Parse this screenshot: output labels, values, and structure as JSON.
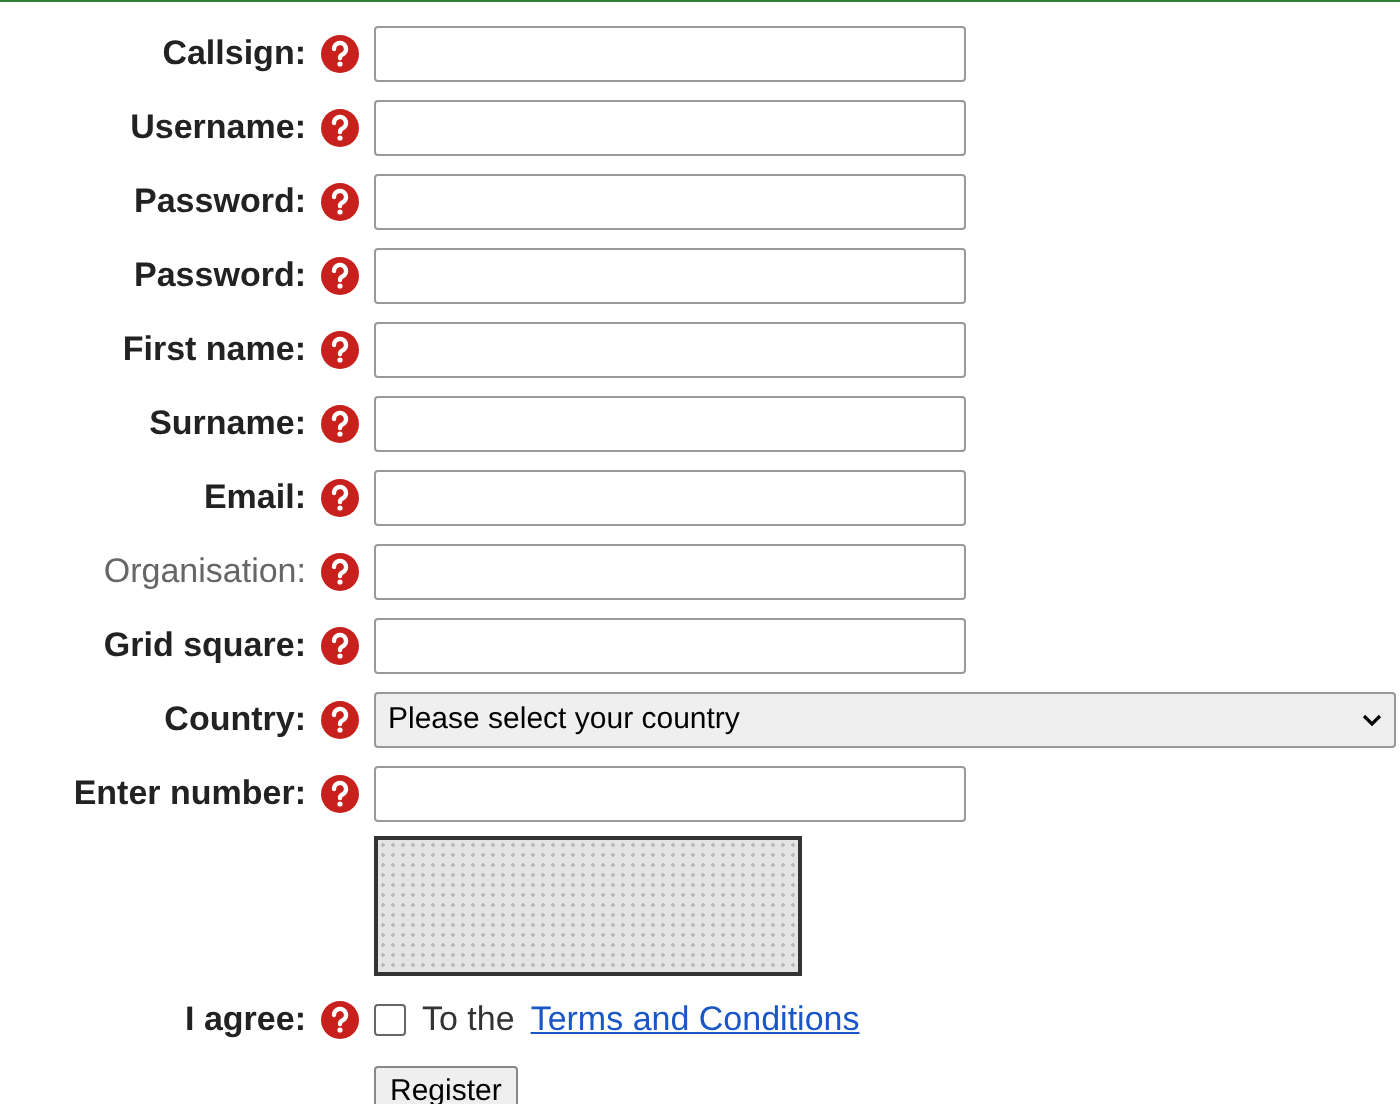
{
  "fields": [
    {
      "label": "Callsign:",
      "required": true,
      "kind": "input"
    },
    {
      "label": "Username:",
      "required": true,
      "kind": "input"
    },
    {
      "label": "Password:",
      "required": true,
      "kind": "input"
    },
    {
      "label": "Password:",
      "required": true,
      "kind": "input"
    },
    {
      "label": "First name:",
      "required": true,
      "kind": "input"
    },
    {
      "label": "Surname:",
      "required": true,
      "kind": "input"
    },
    {
      "label": "Email:",
      "required": true,
      "kind": "input"
    },
    {
      "label": "Organisation:",
      "required": false,
      "kind": "input"
    },
    {
      "label": "Grid square:",
      "required": true,
      "kind": "input"
    },
    {
      "label": "Country:",
      "required": true,
      "kind": "select",
      "value": "Please select your country"
    },
    {
      "label": "Enter number:",
      "required": true,
      "kind": "input"
    }
  ],
  "agree": {
    "label": "I agree:",
    "checked": false,
    "text": "To the",
    "link": "Terms and Conditions"
  },
  "submit": "Register"
}
